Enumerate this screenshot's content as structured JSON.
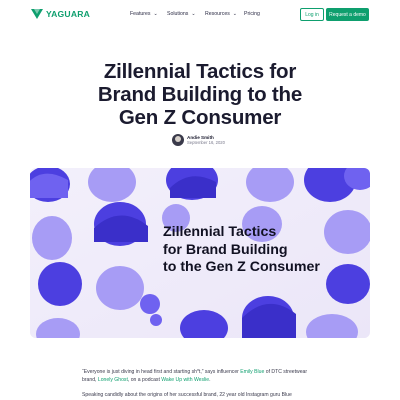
{
  "header": {
    "logo_text": "YAGUARA",
    "nav": [
      {
        "label": "Features",
        "has_dropdown": true
      },
      {
        "label": "Solutions",
        "has_dropdown": true
      },
      {
        "label": "Resources",
        "has_dropdown": true
      },
      {
        "label": "Pricing",
        "has_dropdown": false
      }
    ],
    "login_label": "Log in",
    "demo_label": "Request a demo"
  },
  "article": {
    "title_lines": [
      "Zillennial Tactics for",
      "Brand Building to the",
      "Gen Z Consumer"
    ],
    "author_name": "Andie Smith",
    "date": "September 16, 2020"
  },
  "hero": {
    "text_lines": [
      "Zillennial Tactics",
      "for Brand Building",
      "to the Gen Z Consumer"
    ]
  },
  "body": {
    "p1": {
      "t1": "“Everyone is just diving in head first and starting sh*t,” says influencer ",
      "l1": "Emily Blue",
      "t2": " of DTC streetwear brand, ",
      "l2": "Lonely Ghost",
      "t3": ", on a podcast ",
      "l3": "Wake Up with Weslie",
      "t4": "."
    },
    "p2": "Speaking candidly about the origins of her successful brand, 22 year old Instagram guru Blue"
  },
  "colors": {
    "brand": "#0e9f6e",
    "hero_bg": "#f1eefa",
    "head_primary": "#4c3fe0",
    "head_light": "#a79cf5"
  },
  "icons": {
    "logo": "yaguara-logo-icon",
    "dropdown": "chevron-down-icon"
  }
}
